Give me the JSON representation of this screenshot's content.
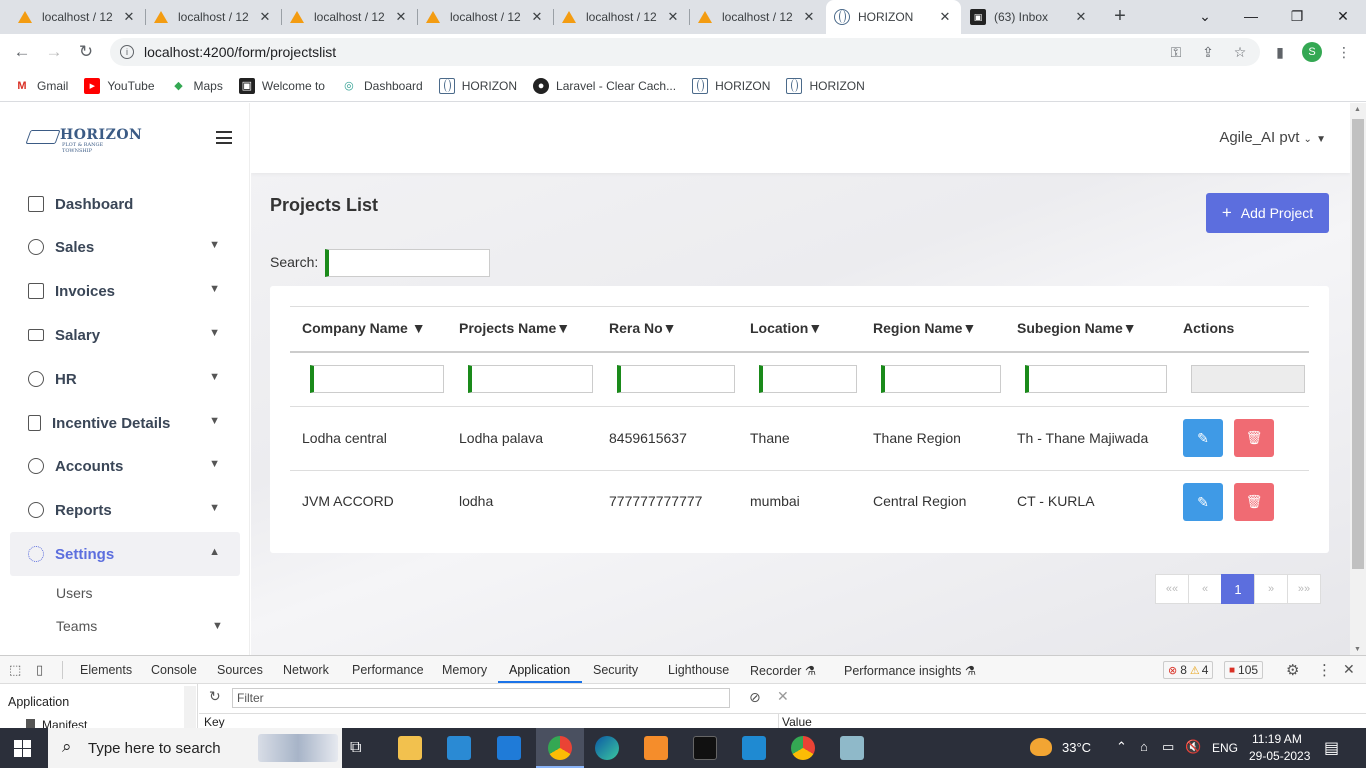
{
  "browser": {
    "tabs": [
      {
        "title": "localhost / 12",
        "icon": "phpmyadmin-icon"
      },
      {
        "title": "localhost / 12",
        "icon": "phpmyadmin-icon"
      },
      {
        "title": "localhost / 12",
        "icon": "phpmyadmin-icon"
      },
      {
        "title": "localhost / 12",
        "icon": "phpmyadmin-icon"
      },
      {
        "title": "localhost / 12",
        "icon": "phpmyadmin-icon"
      },
      {
        "title": "localhost / 12",
        "icon": "phpmyadmin-icon"
      },
      {
        "title": "HORIZON",
        "icon": "globe-icon",
        "active": true
      },
      {
        "title": "(63) Inbox",
        "icon": "inbox-icon"
      }
    ],
    "url": "localhost:4200/form/projectslist",
    "profile_initial": "S",
    "bookmarks": [
      "Gmail",
      "YouTube",
      "Maps",
      "Welcome to",
      "Dashboard",
      "HORIZON",
      "Laravel - Clear Cach...",
      "HORIZON",
      "HORIZON"
    ]
  },
  "app": {
    "logo_text": "HORIZON",
    "logo_sub": "PLOT & RANGE TOWNSHIP",
    "sidebar": [
      {
        "label": "Dashboard",
        "has_chevron": false
      },
      {
        "label": "Sales",
        "has_chevron": true
      },
      {
        "label": "Invoices",
        "has_chevron": true
      },
      {
        "label": "Salary",
        "has_chevron": true
      },
      {
        "label": "HR",
        "has_chevron": true
      },
      {
        "label": "Incentive Details",
        "has_chevron": true
      },
      {
        "label": "Accounts",
        "has_chevron": true
      },
      {
        "label": "Reports",
        "has_chevron": true
      },
      {
        "label": "Settings",
        "has_chevron": true,
        "active": true
      }
    ],
    "settings_sub": [
      "Users",
      "Teams"
    ],
    "user": "Agile_AI pvt",
    "page_title": "Projects List",
    "add_button": "Add Project",
    "search_label": "Search:",
    "table": {
      "headers": [
        "Company Name ▼",
        "Projects Name▼",
        "Rera No▼",
        "Location▼",
        "Region Name▼",
        "Subegion Name▼",
        "Actions"
      ],
      "rows": [
        [
          "Lodha central",
          "Lodha palava",
          "8459615637",
          "Thane",
          "Thane Region",
          "Th - Thane Majiwada"
        ],
        [
          "JVM ACCORD",
          "lodha",
          "777777777777",
          "mumbai",
          "Central Region",
          "CT - KURLA"
        ]
      ]
    },
    "pagination": {
      "first": "««",
      "prev": "«",
      "current": "1",
      "next": "»",
      "last": "»»"
    }
  },
  "devtools": {
    "tabs": [
      "Elements",
      "Console",
      "Sources",
      "Network",
      "Performance",
      "Memory",
      "Application",
      "Security",
      "Lighthouse",
      "Recorder ⚗",
      "Performance insights ⚗"
    ],
    "selected_tab": "Application",
    "errors": "8",
    "warnings": "4",
    "issues": "105",
    "left_title": "Application",
    "left_item": "Manifest",
    "filter_placeholder": "Filter",
    "col_key": "Key",
    "col_value": "Value"
  },
  "taskbar": {
    "search_placeholder": "Type here to search",
    "weather": "33°C",
    "lang": "ENG",
    "time": "11:19 AM",
    "date": "29-05-2023"
  }
}
